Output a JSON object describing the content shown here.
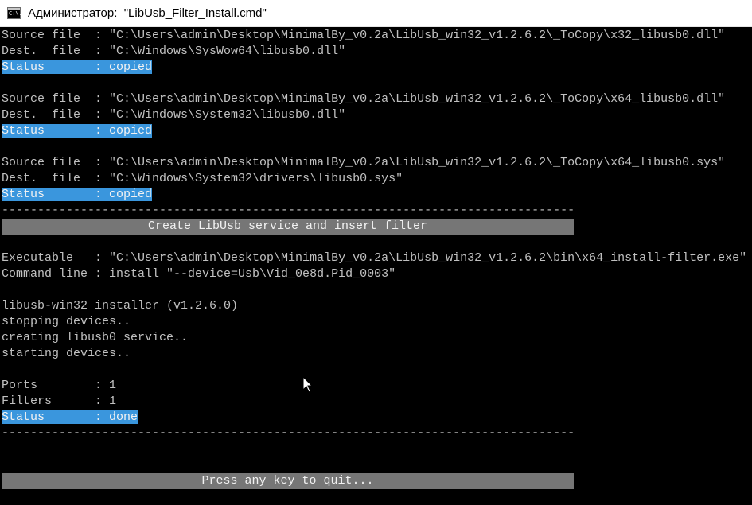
{
  "window": {
    "title": "Администратор:  \"LibUsb_Filter_Install.cmd\"",
    "icon": "cmd-console-icon",
    "icon_glyph": "C:\\."
  },
  "console": {
    "block1": {
      "source": "Source file  : \"C:\\Users\\admin\\Desktop\\MinimalBy_v0.2a\\LibUsb_win32_v1.2.6.2\\_ToCopy\\x32_libusb0.dll\"",
      "dest": "Dest.  file  : \"C:\\Windows\\SysWow64\\libusb0.dll\"",
      "status": "Status       : copied"
    },
    "block2": {
      "source": "Source file  : \"C:\\Users\\admin\\Desktop\\MinimalBy_v0.2a\\LibUsb_win32_v1.2.6.2\\_ToCopy\\x64_libusb0.dll\"",
      "dest": "Dest.  file  : \"C:\\Windows\\System32\\libusb0.dll\"",
      "status": "Status       : copied"
    },
    "block3": {
      "source": "Source file  : \"C:\\Users\\admin\\Desktop\\MinimalBy_v0.2a\\LibUsb_win32_v1.2.6.2\\_ToCopy\\x64_libusb0.sys\"",
      "dest": "Dest.  file  : \"C:\\Windows\\System32\\drivers\\libusb0.sys\"",
      "status": "Status       : copied"
    },
    "separator": "----------------------------------------------------------------------------------------------------",
    "section_header": "Create LibUsb service and insert filter",
    "executable": "Executable   : \"C:\\Users\\admin\\Desktop\\MinimalBy_v0.2a\\LibUsb_win32_v1.2.6.2\\bin\\x64_install-filter.exe\"",
    "command_line": "Command line : install \"--device=Usb\\Vid_0e8d.Pid_0003\"",
    "installer_lines": [
      "libusb-win32 installer (v1.2.6.0)",
      "stopping devices..",
      "creating libusb0 service..",
      "starting devices.."
    ],
    "ports": "Ports        : 1",
    "filters": "Filters      : 1",
    "final_status": "Status       : done",
    "prompt": "Press any key to quit..."
  },
  "colors": {
    "console_bg": "#000000",
    "console_text": "#c0c0c0",
    "highlight_bg": "#3a96dd",
    "band_bg": "#767676"
  }
}
